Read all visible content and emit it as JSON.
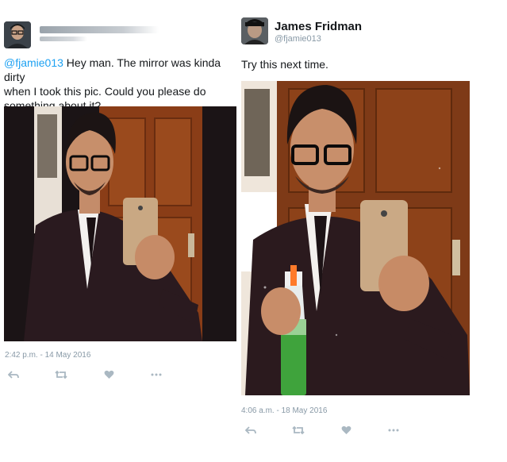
{
  "left_tweet": {
    "text_mention": "@fjamie013",
    "text_body_line1": " Hey man. The mirror was kinda dirty",
    "text_line2": "when I took this pic. Could you please do",
    "text_line3": "something about it?",
    "timestamp": "2:42 p.m. - 14 May 2016",
    "icons": [
      "reply-icon",
      "retweet-icon",
      "like-icon",
      "more-icon"
    ]
  },
  "right_tweet": {
    "display_name": "James Fridman",
    "handle": "@fjamie013",
    "text": "Try this next time.",
    "timestamp": "4:06 a.m. - 18 May 2016",
    "icons": [
      "reply-icon",
      "retweet-icon",
      "like-icon",
      "more-icon"
    ]
  },
  "colors": {
    "link": "#1da1f2",
    "muted": "#8899a6",
    "action": "#aab8c2"
  }
}
